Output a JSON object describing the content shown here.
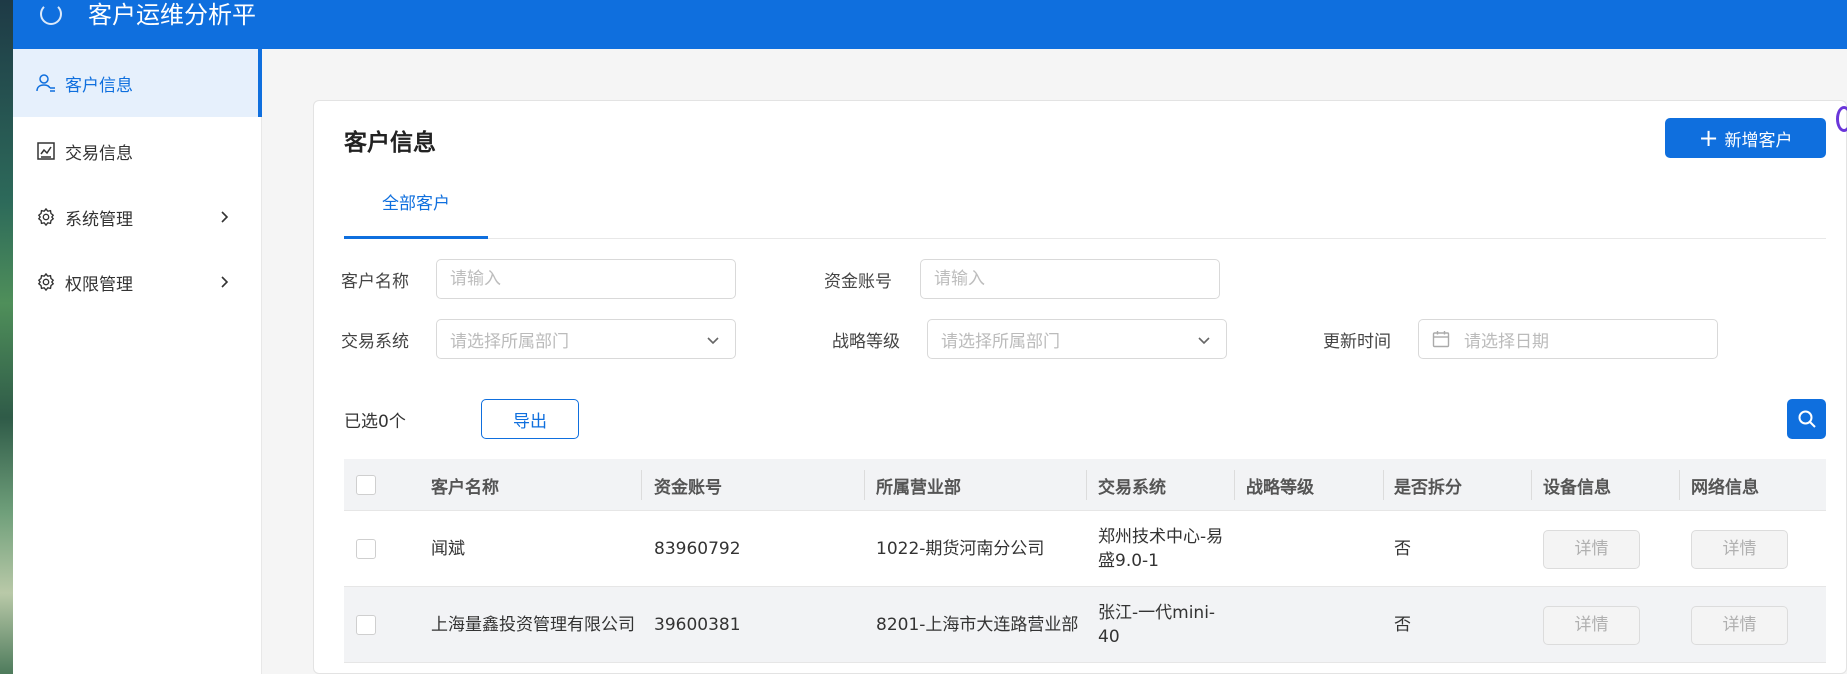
{
  "app": {
    "title": "客户运维分析平"
  },
  "sidebar": {
    "items": [
      {
        "label": "客户信息",
        "icon": "user-icon",
        "active": true
      },
      {
        "label": "交易信息",
        "icon": "chart-icon",
        "active": false
      },
      {
        "label": "系统管理",
        "icon": "gear-icon",
        "active": false,
        "expandable": true
      },
      {
        "label": "权限管理",
        "icon": "gear-icon",
        "active": false,
        "expandable": true
      }
    ]
  },
  "main": {
    "title": "客户信息",
    "add_button": {
      "icon": "plus",
      "label": "新增客户"
    },
    "tabs": [
      {
        "label": "全部客户",
        "active": true
      }
    ],
    "filters": {
      "customer_name": {
        "label": "客户名称",
        "placeholder": "请输入"
      },
      "fund_account": {
        "label": "资金账号",
        "placeholder": "请输入"
      },
      "trading_system": {
        "label": "交易系统",
        "placeholder": "请选择所属部门"
      },
      "strategy_level": {
        "label": "战略等级",
        "placeholder": "请选择所属部门"
      },
      "update_time": {
        "label": "更新时间",
        "placeholder": "请选择日期"
      }
    },
    "selected_text": "已选0个",
    "export_label": "导出"
  },
  "table": {
    "columns": [
      "客户名称",
      "资金账号",
      "所属营业部",
      "交易系统",
      "战略等级",
      "是否拆分",
      "设备信息",
      "网络信息"
    ],
    "rows": [
      {
        "name": "闻斌",
        "account": "83960792",
        "branch": "1022-期货河南分公司",
        "system": "郑州技术中心-易盛9.0-1",
        "level": "",
        "split": "否",
        "device": "详情",
        "network": "详情"
      },
      {
        "name": "上海量鑫投资管理有限公司",
        "account": "39600381",
        "branch": "8201-上海市大连路营业部",
        "system": "张江-一代mini-40",
        "level": "",
        "split": "否",
        "device": "详情",
        "network": "详情"
      }
    ]
  },
  "colors": {
    "primary": "#0f6fde",
    "header_bg": "#f2f3f5",
    "active_nav_bg": "#e6f0fc"
  }
}
